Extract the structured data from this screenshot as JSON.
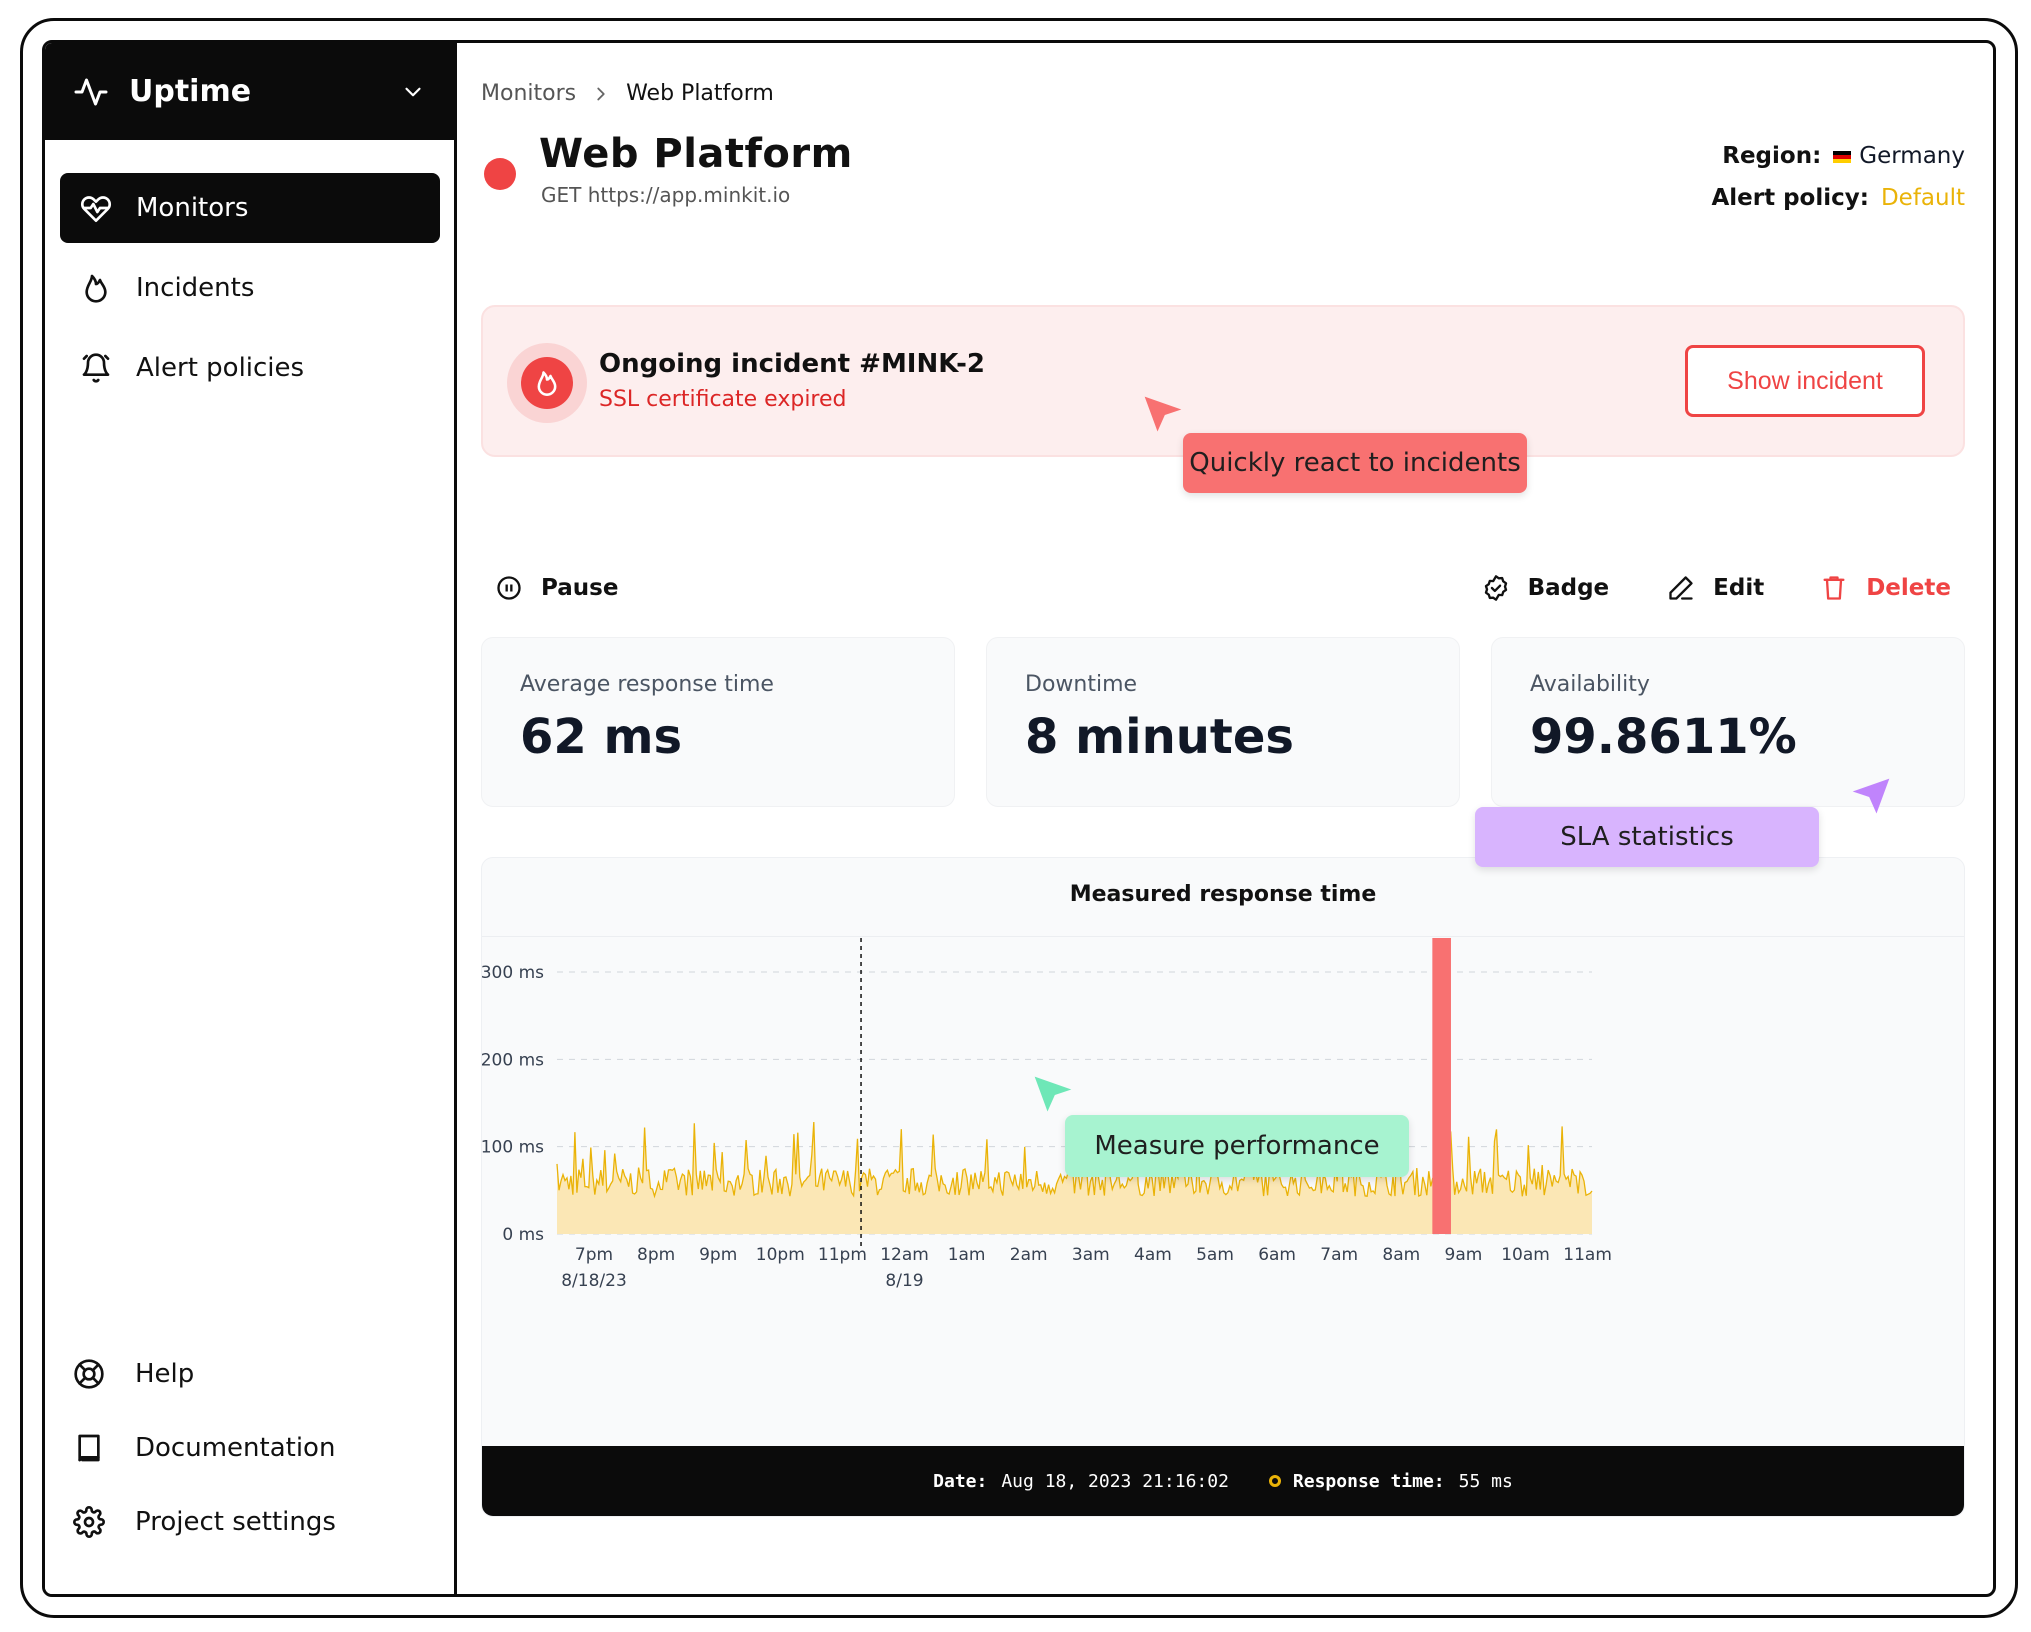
{
  "app": {
    "name": "Uptime",
    "switcher_icon": "chevron-down-icon",
    "logo_icon": "pulse-icon"
  },
  "sidebar": {
    "items": [
      {
        "label": "Monitors",
        "icon": "heart-pulse-icon",
        "active": true
      },
      {
        "label": "Incidents",
        "icon": "flame-icon"
      },
      {
        "label": "Alert policies",
        "icon": "bell-icon"
      }
    ],
    "bottom_items": [
      {
        "label": "Help",
        "icon": "lifebuoy-icon"
      },
      {
        "label": "Documentation",
        "icon": "book-icon"
      },
      {
        "label": "Project settings",
        "icon": "gear-icon"
      }
    ]
  },
  "breadcrumb": {
    "root": "Monitors",
    "current": "Web Platform"
  },
  "monitor": {
    "title": "Web Platform",
    "request": "GET https://app.minkit.io",
    "status_color": "#ef4444",
    "region_label": "Region:",
    "region_value": "Germany",
    "alert_policy_label": "Alert policy:",
    "alert_policy_value": "Default"
  },
  "incident": {
    "title": "Ongoing incident #MINK-2",
    "subtitle": "SSL certificate expired",
    "button": "Show incident"
  },
  "callouts": {
    "incidents": "Quickly react to incidents",
    "sla": "SLA statistics",
    "performance": "Measure performance"
  },
  "actions": {
    "pause": "Pause",
    "badge": "Badge",
    "edit": "Edit",
    "delete": "Delete"
  },
  "stats": [
    {
      "label": "Average response time",
      "value": "62 ms"
    },
    {
      "label": "Downtime",
      "value": "8 minutes"
    },
    {
      "label": "Availability",
      "value": "99.8611%"
    }
  ],
  "chart_data": {
    "type": "area",
    "title": "Measured response time",
    "y_ticks": [
      "0 ms",
      "100 ms",
      "200 ms",
      "300 ms"
    ],
    "ylim": [
      0,
      300
    ],
    "x_ticks": [
      "7pm",
      "8pm",
      "9pm",
      "10pm",
      "11pm",
      "12am",
      "1am",
      "2am",
      "3am",
      "4am",
      "5am",
      "6am",
      "7am",
      "8am",
      "9am",
      "10am",
      "11am"
    ],
    "x_sublabels": {
      "7pm": "8/18/23",
      "12am": "8/19"
    },
    "series": [
      {
        "typical_ms": 60,
        "peak_ms": 130,
        "color": "#eab308",
        "fill": "#fbe7b5"
      }
    ],
    "incident_window": {
      "start": "8:30am",
      "end": "8:48am",
      "color": "#f87171"
    },
    "hover_marker": "Aug 18, 2023 21:16:02",
    "grid": true
  },
  "tooltip": {
    "date_label": "Date:",
    "date_value": "Aug 18, 2023 21:16:02",
    "response_label": "Response time:",
    "response_value": "55 ms"
  }
}
